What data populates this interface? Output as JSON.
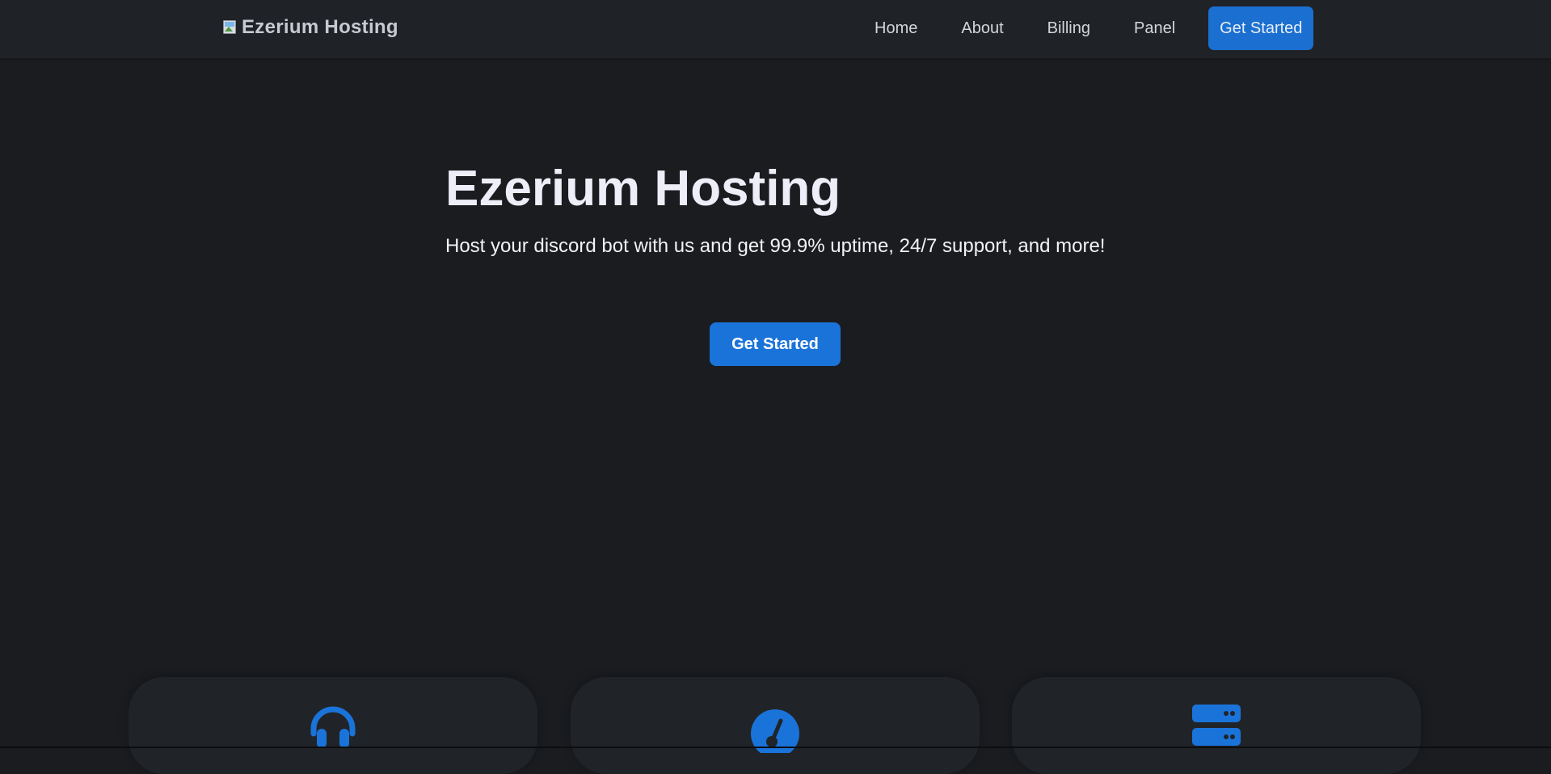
{
  "navbar": {
    "logo_alt": "logo",
    "brand_name": "Ezerium Hosting",
    "links": [
      {
        "label": "Home"
      },
      {
        "label": "About"
      },
      {
        "label": "Billing"
      },
      {
        "label": "Panel"
      }
    ],
    "cta_label": "Get Started"
  },
  "hero": {
    "title": "Ezerium Hosting",
    "subtitle": "Host your discord bot with us and get 99.9% uptime, 24/7 support, and more!",
    "cta_label": "Get Started"
  },
  "features": [
    {
      "icon": "headset-icon"
    },
    {
      "icon": "gauge-icon"
    },
    {
      "icon": "server-icon"
    }
  ],
  "colors": {
    "background": "#1a1c20",
    "navbar": "#1f2226",
    "accent": "#1a73d9",
    "card": "#202428"
  }
}
